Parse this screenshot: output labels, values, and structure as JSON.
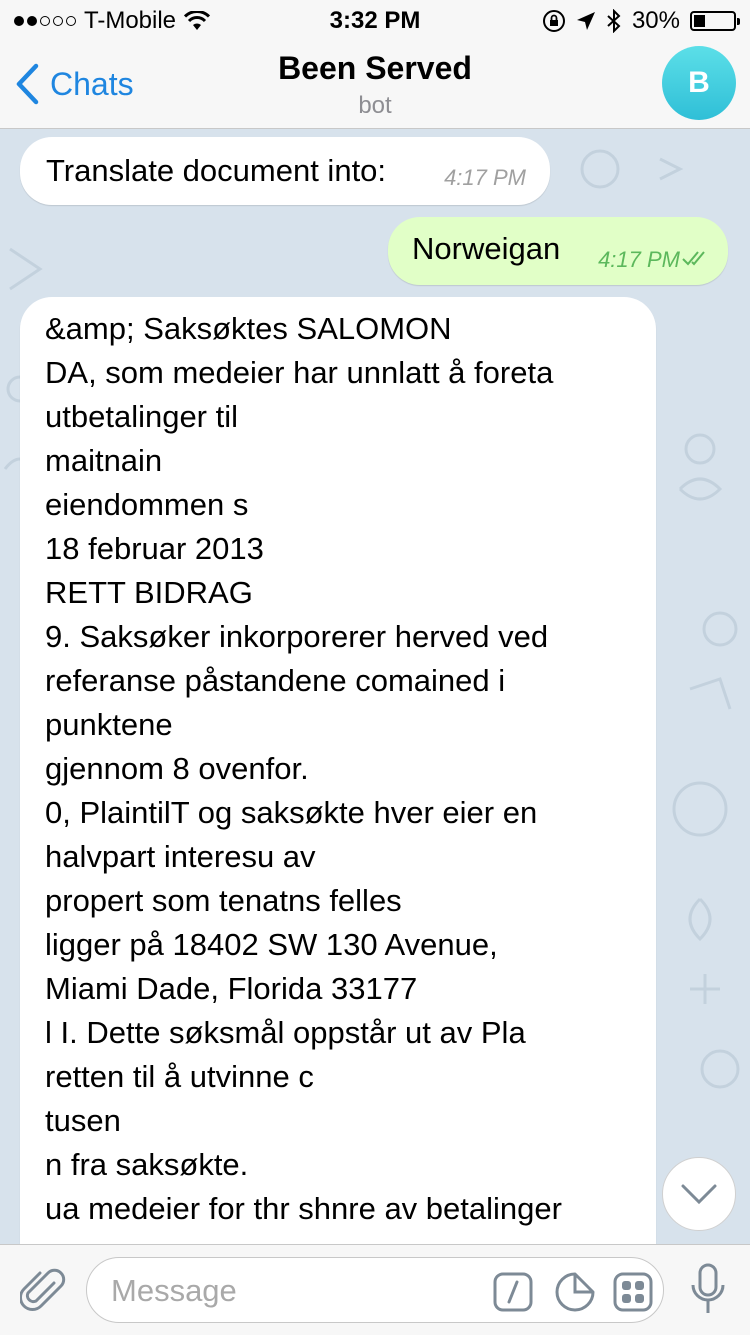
{
  "status_bar": {
    "carrier": "T-Mobile",
    "time": "3:32 PM",
    "battery": "30%",
    "battery_level": 0.3
  },
  "nav": {
    "back_label": "Chats",
    "title": "Been Served",
    "subtitle": "bot",
    "avatar_letter": "B"
  },
  "messages": [
    {
      "direction": "incoming",
      "text": "Translate document into:",
      "time": "4:17 PM"
    },
    {
      "direction": "outgoing",
      "text": "Norweigan",
      "time": "4:17 PM",
      "status": "read-double-check"
    },
    {
      "direction": "incoming",
      "text": "&amp; Saksøktes SALOMON\nDA, som medeier har unnlatt å foreta\nutbetalinger til\nmaitnain\neiendommen s\n18 februar 2013\nRETT BIDRAG\n9. Saksøker inkorporerer herved ved\nreferanse påstandene comained i\npunktene\ngjennom 8 ovenfor.\n0, PlaintilT og saksøkte hver eier en\nhalvpart interesu av\npropert som tenatns felles\nligger på 18402 SW 130 Avenue,\nMiami Dade, Florida 33177\nl I. Dette søksmål oppstår ut av Pla\nretten til å utvinne c\ntusen\nn fra saksøkte.\nua medeier for thr shnre av betalinger"
    }
  ],
  "input": {
    "placeholder": "Message",
    "value": ""
  },
  "icons": {
    "attach": "paperclip-icon",
    "command": "slash-command-icon",
    "sticker": "sticker-icon",
    "keyboard": "bot-keyboard-icon",
    "mic": "microphone-icon",
    "scroll": "chevron-down-icon"
  },
  "colors": {
    "accent": "#1f86e0",
    "outgoing_bubble": "#e1ffc7",
    "read_check": "#5cb85c",
    "avatar": "#2fbfd7"
  }
}
